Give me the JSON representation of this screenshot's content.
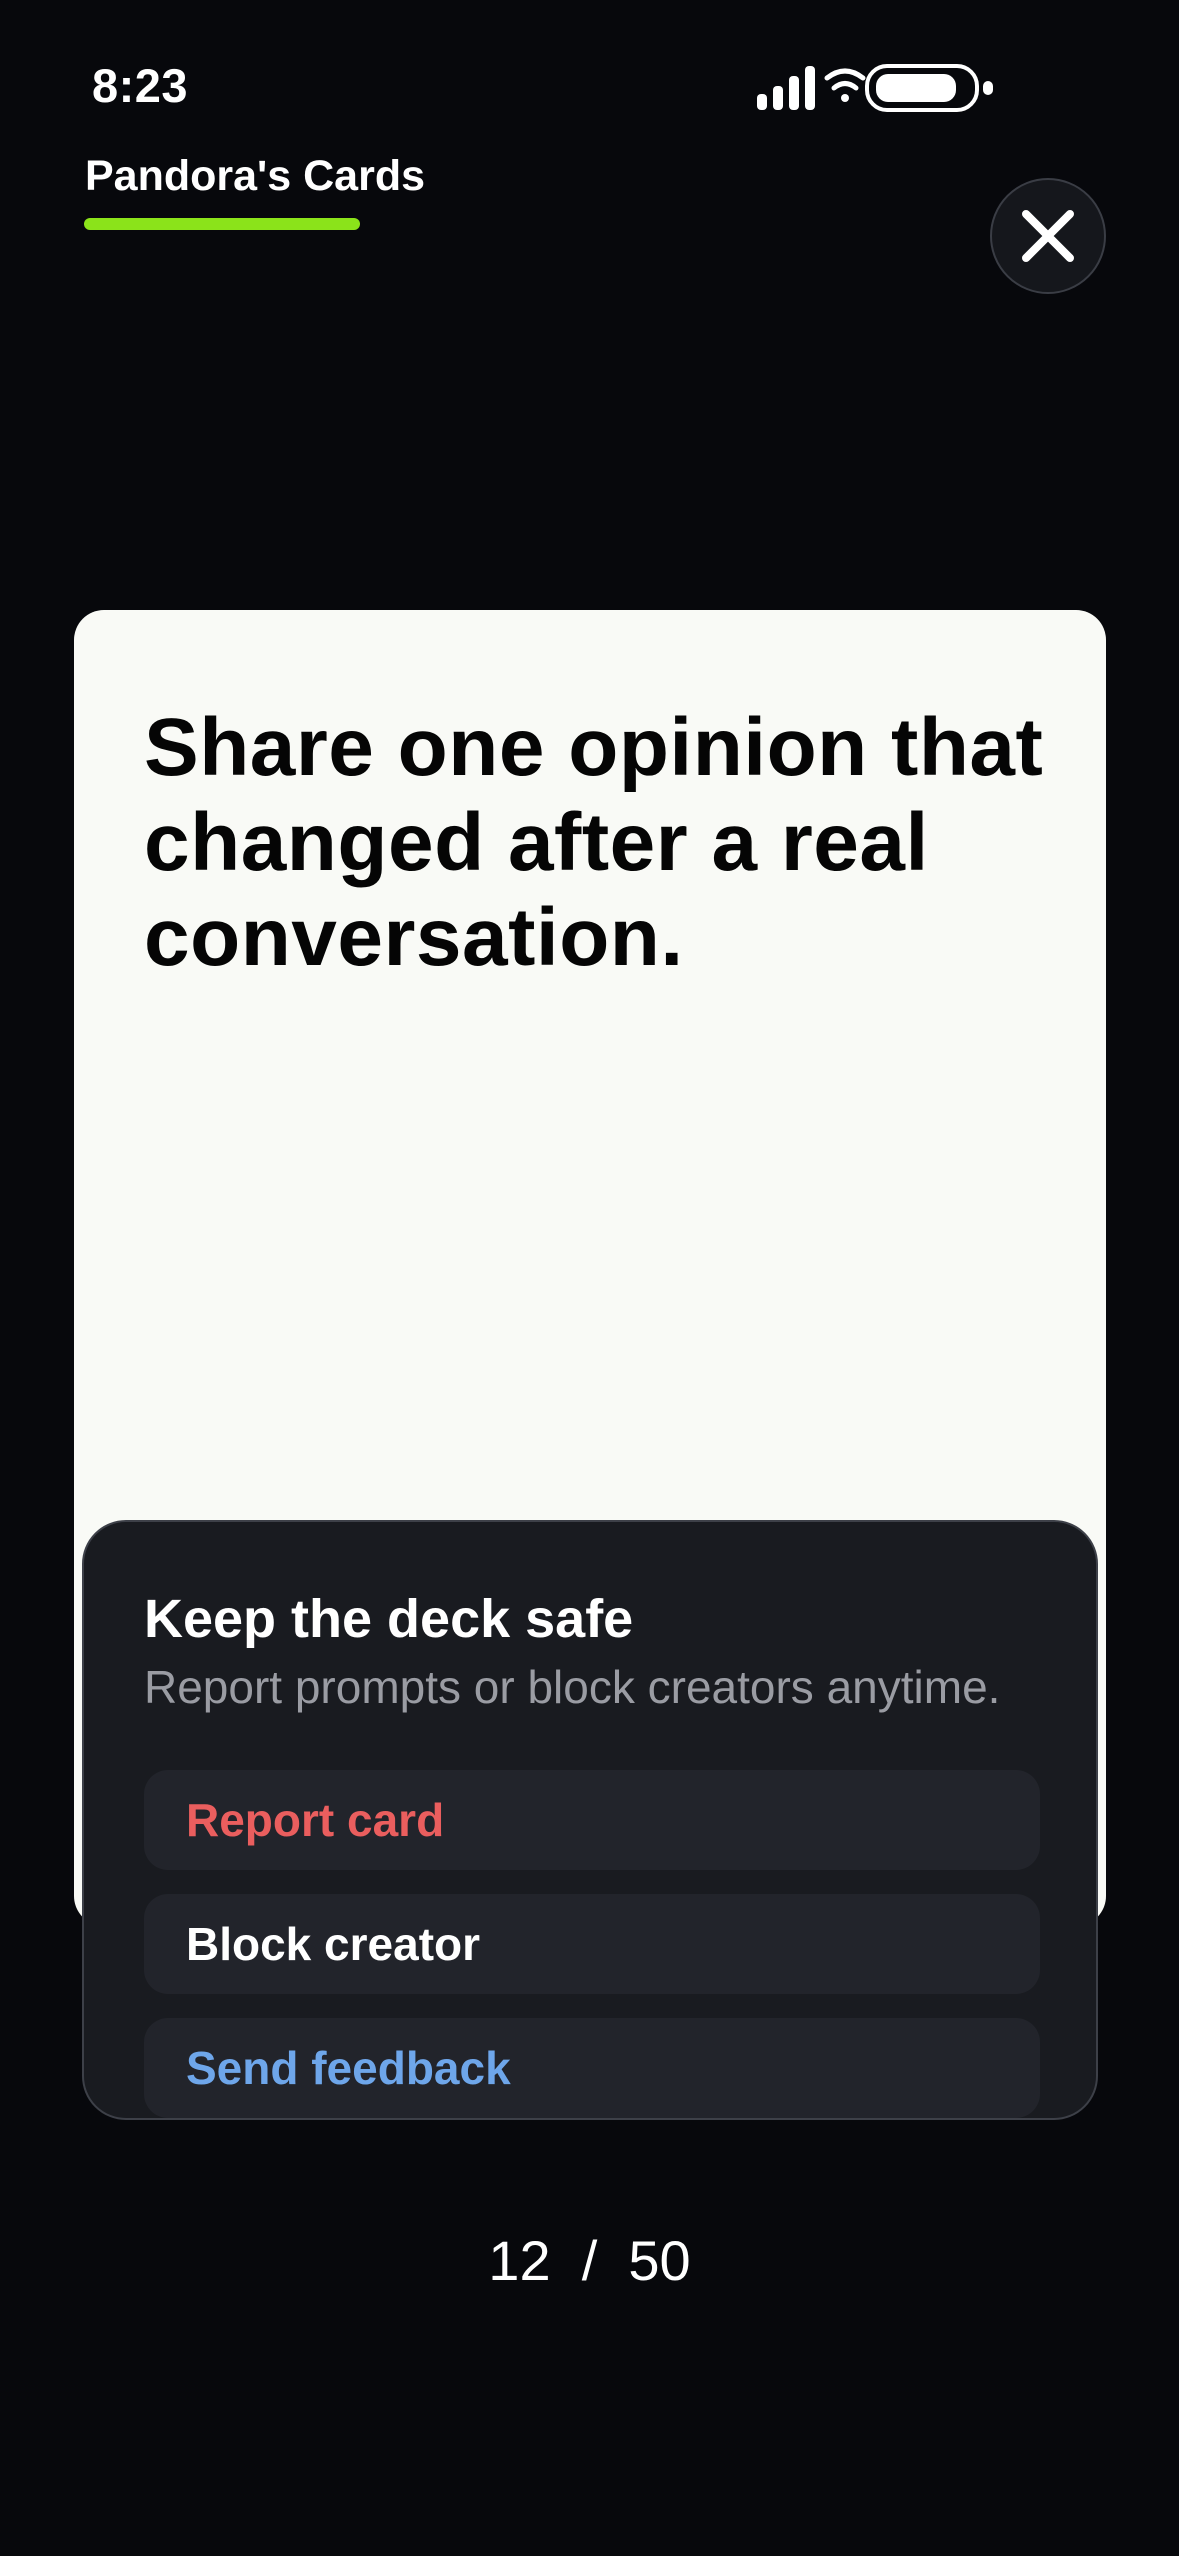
{
  "status_bar": {
    "time": "8:23"
  },
  "header": {
    "title": "Pandora's Cards",
    "accent_color": "#8be31a",
    "close_icon": "close-icon"
  },
  "card": {
    "prompt": "Share one opinion that changed after a real conversation."
  },
  "safety_sheet": {
    "title": "Keep the deck safe",
    "subtitle": "Report prompts or block creators anytime.",
    "actions": [
      {
        "label": "Report card",
        "color": "#ea5e5e"
      },
      {
        "label": "Block creator",
        "color": "#ffffff"
      },
      {
        "label": "Send feedback",
        "color": "#6ea6ea"
      }
    ]
  },
  "pager": {
    "current": "12",
    "separator": "/",
    "total": "50"
  }
}
